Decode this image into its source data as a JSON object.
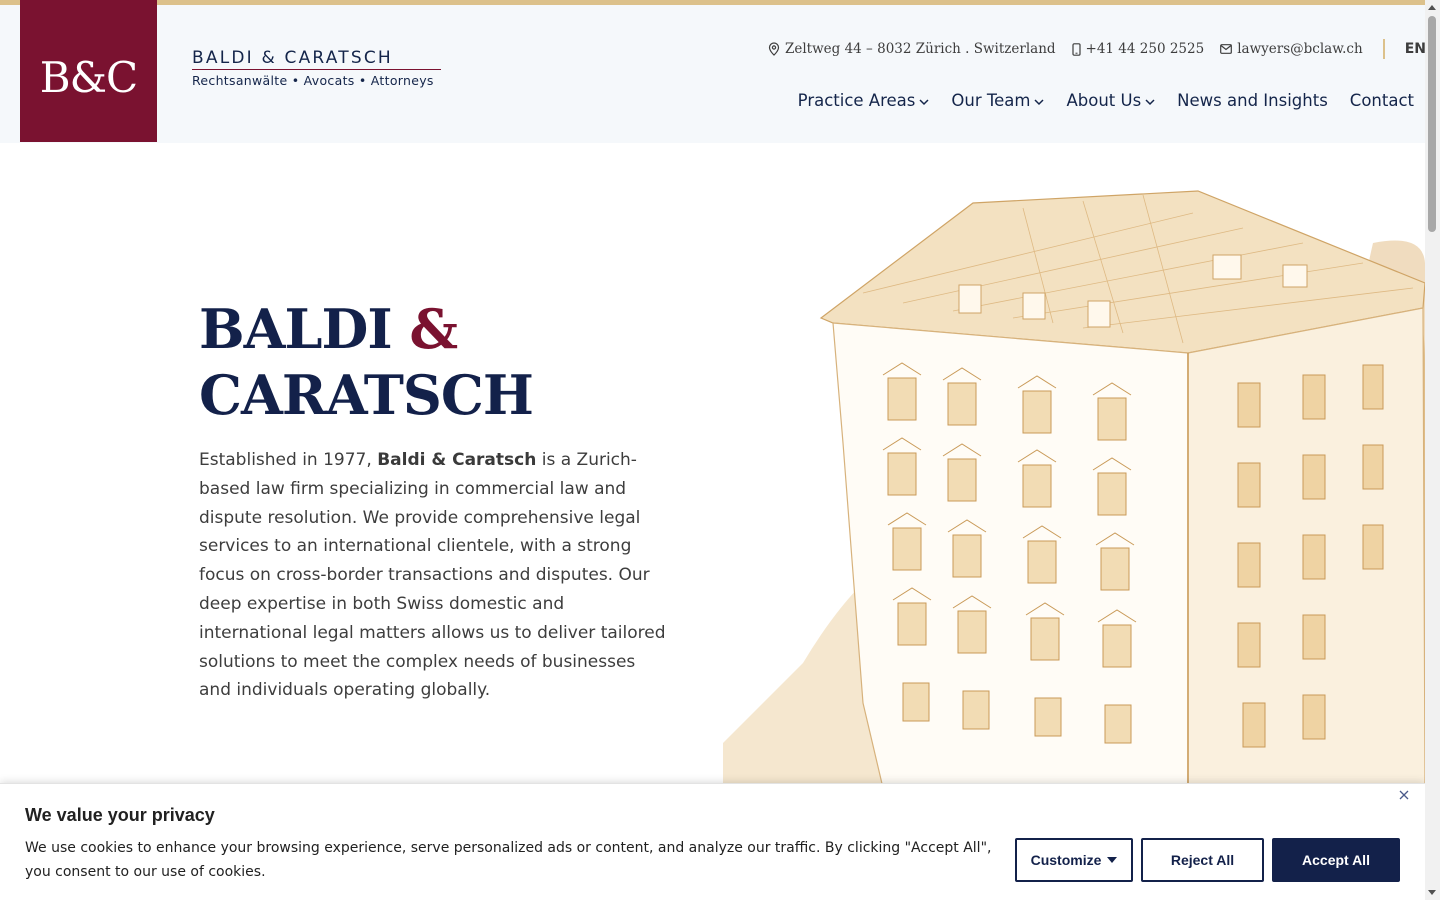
{
  "brand": {
    "monogram": "B&C",
    "name": "BALDI & CARATSCH",
    "tagline": "Rechtsanwälte • Avocats • Attorneys"
  },
  "contact": {
    "address": "Zeltweg 44 – 8032 Zürich . Switzerland",
    "phone": "+41 44 250 2525",
    "email": "lawyers@bclaw.ch",
    "language": "EN"
  },
  "nav": {
    "items": [
      {
        "label": "Practice Areas",
        "dropdown": true
      },
      {
        "label": "Our Team",
        "dropdown": true
      },
      {
        "label": "About Us",
        "dropdown": true
      },
      {
        "label": "News and Insights",
        "dropdown": false
      },
      {
        "label": "Contact",
        "dropdown": false
      }
    ]
  },
  "hero": {
    "title_part1": "BALDI ",
    "title_amp": "&",
    "title_part2": "CARATSCH",
    "body_lead": "Established in 1977, ",
    "body_bold": "Baldi & Caratsch",
    "body_rest": " is a Zurich-based law firm specializing in commercial law and dispute resolution. We provide comprehensive legal services to an international clientele, with a strong focus on cross-border transactions and disputes. Our deep expertise in both Swiss domestic and international legal matters allows us to deliver tailored solutions to meet the complex needs of businesses and individuals operating globally."
  },
  "cookie": {
    "title": "We value your privacy",
    "text": "We use cookies to enhance your browsing experience, serve personalized ads or content, and analyze our traffic. By clicking \"Accept All\", you consent to our use of cookies.",
    "customize_label": "Customize",
    "reject_label": "Reject All",
    "accept_label": "Accept All"
  },
  "colors": {
    "brand_burgundy": "#7a1230",
    "navy": "#13214a",
    "gold": "#dcc18b",
    "header_bg": "#f5f8fb"
  }
}
